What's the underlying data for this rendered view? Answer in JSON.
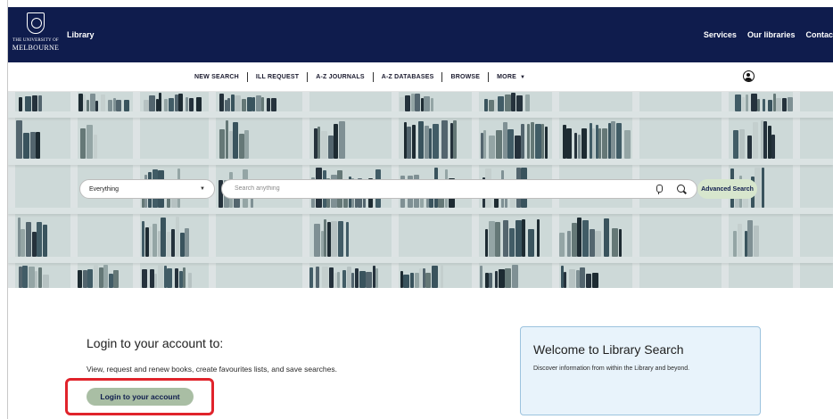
{
  "header": {
    "logo_line1": "THE UNIVERSITY OF",
    "logo_line2": "MELBOURNE",
    "app_title": "Library",
    "links": [
      "Services",
      "Our libraries",
      "Contac"
    ]
  },
  "subnav": {
    "items": [
      "NEW SEARCH",
      "ILL REQUEST",
      "A-Z JOURNALS",
      "A-Z DATABASES",
      "BROWSE",
      "MORE"
    ]
  },
  "search": {
    "scope_value": "Everything",
    "placeholder": "Search anything",
    "advanced_label": "Advanced Search"
  },
  "login": {
    "heading": "Login to your account to:",
    "description": "View, request and renew books, create favourites lists, and save searches.",
    "button_label": "Login to your account"
  },
  "welcome": {
    "title": "Welcome to Library Search",
    "subtitle": "Discover information from within the Library and beyond."
  },
  "colors": {
    "header_bg": "#0f1c4d",
    "login_button": "#a9bea4",
    "advanced_button": "#d7e6cd",
    "highlight": "#e0232b",
    "welcome_bg": "#e8f3fb"
  },
  "icons": [
    "university-crest-icon",
    "user-account-icon",
    "chevron-down-icon",
    "microphone-icon",
    "search-icon"
  ]
}
